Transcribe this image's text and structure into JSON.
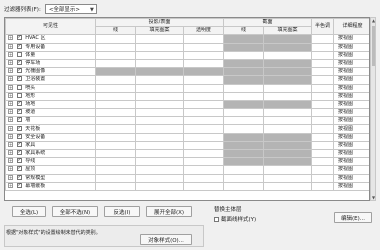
{
  "filter": {
    "label": "过滤器列表(F):",
    "value": "<全部显示>"
  },
  "columns": {
    "visibility": "可见性",
    "projection_group": "投影/表面",
    "line": "线",
    "fill": "填充图案",
    "transparency": "透明度",
    "cut_group": "截面",
    "cut_line": "线",
    "cut_fill": "填充图案",
    "halftone": "半色调",
    "detail_level": "详细程度"
  },
  "rows": [
    {
      "name": "HVAC 区",
      "checked": true,
      "cut_gray": true,
      "detail": "按视图"
    },
    {
      "name": "专用设备",
      "checked": true,
      "cut_gray": true,
      "detail": "按视图"
    },
    {
      "name": "体量",
      "checked": false,
      "cut_gray": false,
      "detail": "按视图"
    },
    {
      "name": "停车场",
      "checked": true,
      "cut_gray": true,
      "detail": "按视图"
    },
    {
      "name": "光栅图像",
      "checked": true,
      "proj_gray": true,
      "cut_gray": true,
      "detail": "按视图"
    },
    {
      "name": "卫浴装置",
      "checked": true,
      "cut_gray": true,
      "detail": "按视图"
    },
    {
      "name": "喷头",
      "checked": false,
      "cut_gray": false,
      "detail": "按视图"
    },
    {
      "name": "地形",
      "checked": false,
      "cut_gray": false,
      "detail": "按视图"
    },
    {
      "name": "场地",
      "checked": true,
      "cut_gray": true,
      "detail": "按视图"
    },
    {
      "name": "坡道",
      "checked": true,
      "cut_gray": false,
      "detail": "按视图"
    },
    {
      "name": "墙",
      "checked": true,
      "cut_gray": false,
      "detail": "按视图"
    },
    {
      "name": "天花板",
      "checked": true,
      "cut_gray": false,
      "detail": "按视图"
    },
    {
      "name": "安全设备",
      "checked": true,
      "cut_gray": true,
      "detail": "按视图"
    },
    {
      "name": "家具",
      "checked": true,
      "cut_gray": true,
      "detail": "按视图"
    },
    {
      "name": "家具系统",
      "checked": true,
      "cut_gray": true,
      "detail": "按视图"
    },
    {
      "name": "导线",
      "checked": true,
      "cut_gray": true,
      "detail": "按视图"
    },
    {
      "name": "屋顶",
      "checked": true,
      "cut_gray": false,
      "detail": "按视图"
    },
    {
      "name": "常规模型",
      "checked": true,
      "cut_gray": false,
      "detail": "按视图"
    },
    {
      "name": "幕墙嵌板",
      "checked": true,
      "cut_gray": false,
      "detail": "按视图"
    }
  ],
  "buttons": {
    "select_all": "全选(L)",
    "select_none": "全部不选(N)",
    "invert": "反选(I)",
    "expand_all": "展开全部(X)",
    "edit": "编辑(E)...",
    "object_styles": "对象样式(O)..."
  },
  "replace": {
    "title": "替换主体层",
    "checkbox_label": "截面线样式(Y)",
    "checked": false
  },
  "footer": {
    "text": "根据\"对象样式\"的设置绘制未替代的类别。"
  },
  "colors": {
    "gray_cell": "#b4b4b4",
    "border": "#c8c8c8"
  }
}
